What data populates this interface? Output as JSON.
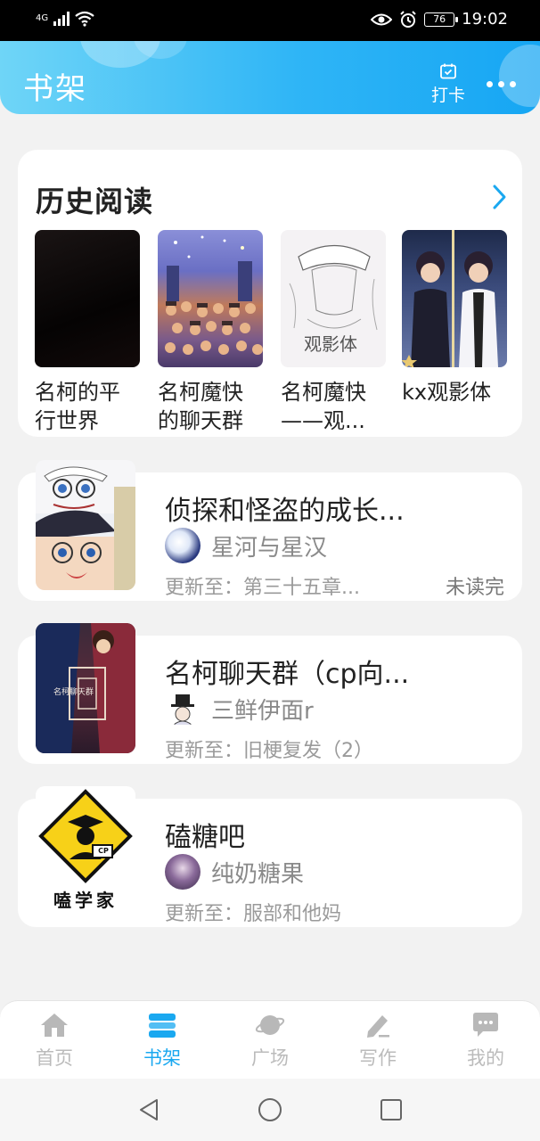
{
  "status_bar": {
    "network": "4G",
    "battery": "76",
    "time": "19:02"
  },
  "header": {
    "title": "书架",
    "checkin_label": "打卡"
  },
  "history": {
    "title": "历史阅读",
    "items": [
      {
        "name": "名柯的平行世界"
      },
      {
        "name": "名柯魔快的聊天群"
      },
      {
        "name": "名柯魔快——观..."
      },
      {
        "name": "kx观影体"
      }
    ]
  },
  "books": [
    {
      "title": "侦探和怪盗的成长...",
      "author": "星河与星汉",
      "update": "更新至：第三十五章...",
      "status": "未读完"
    },
    {
      "title": "名柯聊天群（cp向...",
      "author": "三鲜伊面r",
      "update": "更新至：旧梗复发（2）",
      "status": ""
    },
    {
      "title": "磕糖吧",
      "author": "纯奶糖果",
      "update": "更新至：服部和他妈",
      "status": ""
    }
  ],
  "cover_texts": {
    "history_3": "观影体",
    "book_3": "嗑学家",
    "book_3_badge": "CP"
  },
  "nav": {
    "home": "首页",
    "shelf": "书架",
    "plaza": "广场",
    "write": "写作",
    "mine": "我的"
  },
  "colors": {
    "accent": "#1aa8f0",
    "header_start": "#6fd5f7",
    "header_end": "#16a6f3"
  }
}
